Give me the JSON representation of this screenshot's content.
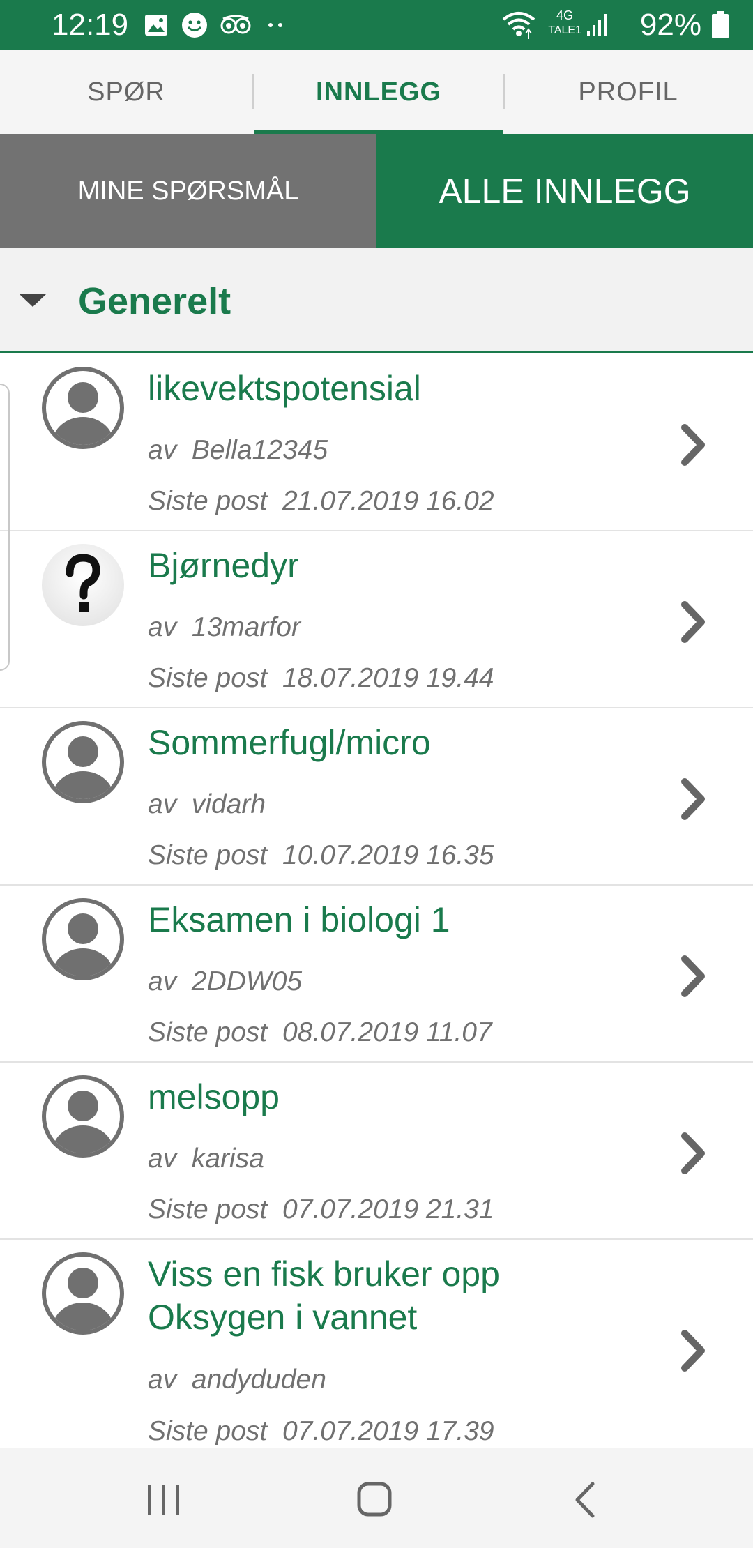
{
  "status_bar": {
    "time": "12:19",
    "battery": "92%",
    "network": "4G",
    "carrier": "TALE1",
    "left_icons": [
      "image-icon",
      "smiley-icon",
      "owl-icon",
      "more-dots-icon"
    ],
    "right_icons": [
      "wifi-icon",
      "signal-icon",
      "battery-icon"
    ]
  },
  "tabs": [
    {
      "label": "SPØR",
      "active": false
    },
    {
      "label": "INNLEGG",
      "active": true
    },
    {
      "label": "PROFIL",
      "active": false
    }
  ],
  "segment": {
    "left": "MINE SPØRSMÅL",
    "right": "ALLE INNLEGG"
  },
  "section": {
    "title": "Generelt"
  },
  "posts": [
    {
      "title": "likevektspotensial",
      "by_label": "av",
      "author": "Bella12345",
      "last_label": "Siste post",
      "last_post": "21.07.2019 16.02",
      "avatar": "user-avatar-icon"
    },
    {
      "title": "Bjørnedyr",
      "by_label": "av",
      "author": "13marfor",
      "last_label": "Siste post",
      "last_post": "18.07.2019 19.44",
      "avatar": "question-mark-icon"
    },
    {
      "title": "Sommerfugl/micro",
      "by_label": "av",
      "author": "vidarh",
      "last_label": "Siste post",
      "last_post": "10.07.2019 16.35",
      "avatar": "user-avatar-icon"
    },
    {
      "title": "Eksamen i biologi 1",
      "by_label": "av",
      "author": "2DDW05",
      "last_label": "Siste post",
      "last_post": "08.07.2019 11.07",
      "avatar": "user-avatar-icon"
    },
    {
      "title": "melsopp",
      "by_label": "av",
      "author": "karisa",
      "last_label": "Siste post",
      "last_post": "07.07.2019 21.31",
      "avatar": "user-avatar-icon"
    },
    {
      "title": "Viss en fisk bruker opp Oksygen i vannet",
      "title_lines": [
        "Viss en fisk bruker opp",
        "Oksygen i vannet"
      ],
      "by_label": "av",
      "author": "andyduden",
      "last_label": "Siste post",
      "last_post": "07.07.2019 17.39",
      "avatar": "user-avatar-icon"
    }
  ],
  "nav": [
    "recent-apps-icon",
    "home-icon",
    "back-icon"
  ],
  "colors": {
    "primary": "#1a7a4c",
    "segment_inactive": "#727272",
    "text_gray": "#707070"
  }
}
